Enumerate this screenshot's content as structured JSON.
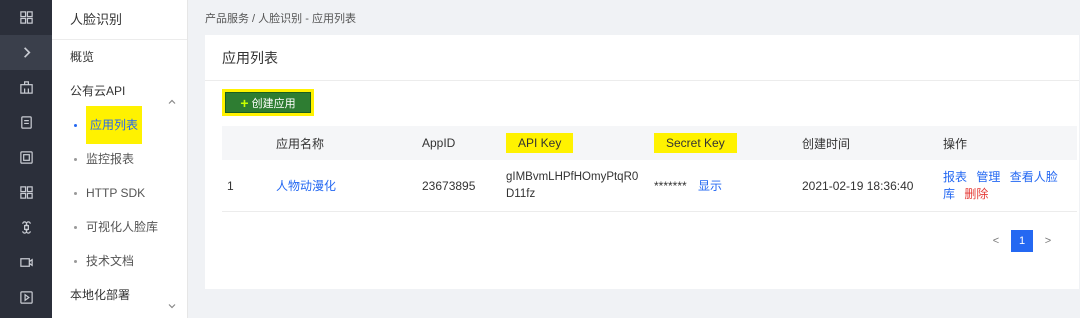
{
  "breadcrumb": "产品服务 / 人脸识别 - 应用列表",
  "sidebar": {
    "title": "人脸识别",
    "items": [
      {
        "label": "概览"
      },
      {
        "label": "公有云API"
      },
      {
        "label": "应用列表"
      },
      {
        "label": "监控报表"
      },
      {
        "label": "HTTP SDK"
      },
      {
        "label": "可视化人脸库"
      },
      {
        "label": "技术文档"
      },
      {
        "label": "本地化部署"
      }
    ]
  },
  "rail_icons": [
    "grid-icon",
    "chevron-right-icon",
    "building-icon",
    "document-icon",
    "report-icon",
    "apps-icon",
    "command-icon",
    "video-icon",
    "play-icon"
  ],
  "panel": {
    "title": "应用列表",
    "create_label": "创建应用"
  },
  "table": {
    "headers": [
      "应用名称",
      "AppID",
      "API Key",
      "Secret Key",
      "创建时间",
      "操作"
    ],
    "rows": [
      {
        "index": "1",
        "name": "人物动漫化",
        "appid": "23673895",
        "api_key_line1": "gIMBvmLHPfHOmyPtqR0",
        "api_key_line2": "D11fz",
        "secret_mask": "*******",
        "secret_show": "显示",
        "created": "2021-02-19 18:36:40",
        "op_report": "报表",
        "op_manage": "管理",
        "op_view_a": "查看人脸",
        "op_view_b": "库",
        "op_delete": "删除"
      }
    ]
  },
  "pager": {
    "prev": "<",
    "page": "1",
    "next": ">"
  },
  "colors": {
    "accent": "#2468f2",
    "highlight": "#fff200",
    "danger": "#e53935",
    "button": "#2e7d32"
  }
}
